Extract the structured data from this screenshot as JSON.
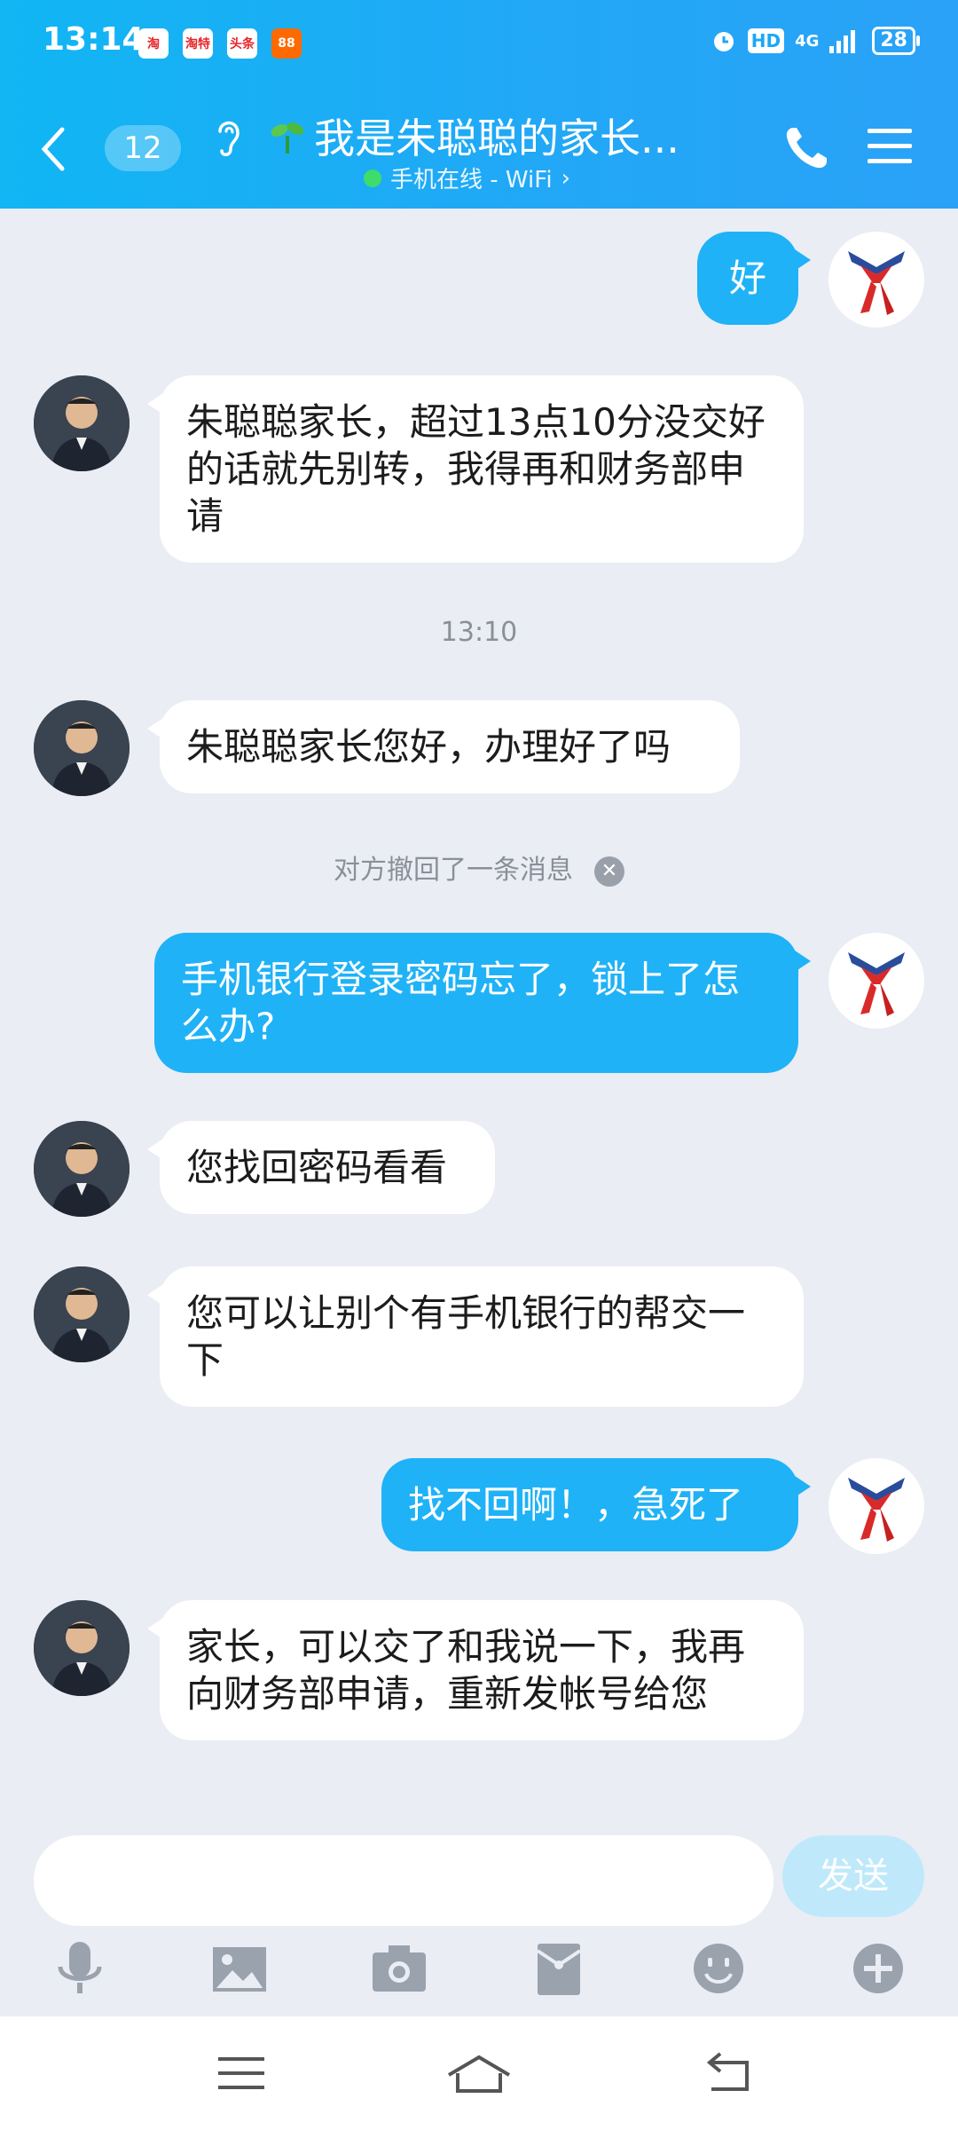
{
  "status_bar": {
    "time": "13:14",
    "apps": [
      "淘",
      "淘特",
      "头条",
      "88"
    ],
    "hd": "HD",
    "network": "4G",
    "battery": "28"
  },
  "header": {
    "unread_count": "12",
    "title": "我是朱聪聪的家长...",
    "status": "手机在线 - WiFi",
    "status_chevron": "›",
    "accent_color": "#1fb2f7"
  },
  "messages": [
    {
      "side": "out",
      "text": "好"
    },
    {
      "side": "in",
      "text": "朱聪聪家长，超过13点10分没交好的话就先别转，我得再和财务部申请"
    },
    {
      "type": "time",
      "text": "13:10"
    },
    {
      "side": "in",
      "text": "朱聪聪家长您好，办理好了吗"
    },
    {
      "type": "system",
      "text": "对方撤回了一条消息"
    },
    {
      "side": "out",
      "text": "手机银行登录密码忘了，锁上了怎么办?"
    },
    {
      "side": "in",
      "text": "您找回密码看看"
    },
    {
      "side": "in",
      "text": "您可以让别个有手机银行的帮交一下"
    },
    {
      "side": "out",
      "text": "找不回啊！，急死了"
    },
    {
      "side": "in",
      "text": "家长，可以交了和我说一下，我再向财务部申请，重新发帐号给您"
    }
  ],
  "composer": {
    "send_label": "发送",
    "input_value": ""
  },
  "toolbar": {
    "icons": [
      "microphone-icon",
      "image-icon",
      "camera-icon",
      "red-packet-icon",
      "emoji-icon",
      "plus-icon"
    ]
  },
  "navbar": {
    "icons": [
      "menu-icon",
      "home-icon",
      "back-icon"
    ]
  }
}
